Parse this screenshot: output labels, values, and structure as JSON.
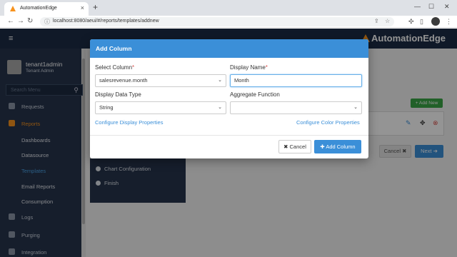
{
  "browser": {
    "tab_title": "AutomationEdge",
    "tab_close": "×",
    "new_tab": "+",
    "url": "localhost:8080/aeui/#/reports/templates/addnew",
    "controls": {
      "minimize": "—",
      "maximize": "☐",
      "close": "✕"
    }
  },
  "header": {
    "menu_glyph": "≡",
    "brand": "AutomationEdge"
  },
  "sidebar": {
    "user": {
      "name": "tenant1admin",
      "role": "Tenant Admin"
    },
    "search_placeholder": "Search Menu",
    "items": [
      {
        "label": "Requests"
      },
      {
        "label": "Reports"
      },
      {
        "label": "Dashboards"
      },
      {
        "label": "Datasource"
      },
      {
        "label": "Templates"
      },
      {
        "label": "Email Reports"
      },
      {
        "label": "Consumption"
      },
      {
        "label": "Logs"
      },
      {
        "label": "Purging"
      },
      {
        "label": "Integration"
      }
    ]
  },
  "wizard": {
    "steps": [
      {
        "label": "Chart Configuration"
      },
      {
        "label": "Finish"
      }
    ]
  },
  "main": {
    "add_new_label": "+ Add New",
    "cancel_label": "Cancel ✖",
    "next_label": "Next ➔"
  },
  "modal": {
    "title": "Add Column",
    "select_column_label": "Select Column",
    "select_column_value": "salesrevenue.month",
    "display_name_label": "Display Name",
    "display_name_value": "Month",
    "display_type_label": "Display Data Type",
    "display_type_value": "String",
    "aggregate_label": "Aggregate Function",
    "aggregate_value": "",
    "required_mark": "*",
    "link_display_props": "Configure Display Properties",
    "link_color_props": "Configure Color Properties",
    "cancel_label": "✖ Cancel",
    "add_label": "✚ Add Column"
  }
}
